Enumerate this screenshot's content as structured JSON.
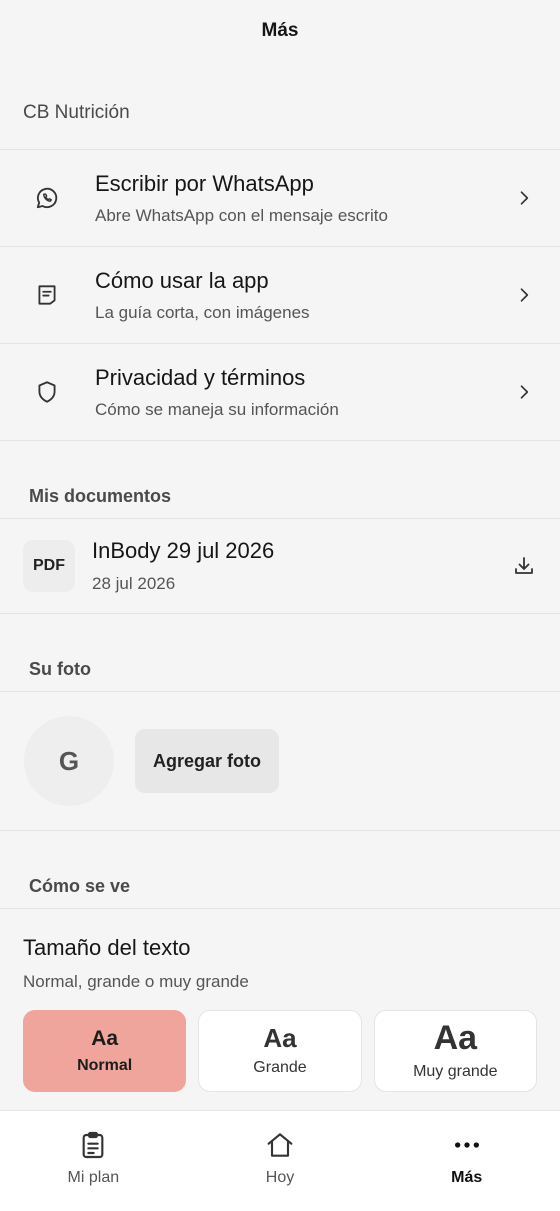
{
  "header": {
    "title": "Más"
  },
  "org": {
    "name": "CB Nutrición"
  },
  "menu": [
    {
      "title": "Escribir por WhatsApp",
      "subtitle": "Abre WhatsApp con el mensaje escrito",
      "icon": "whatsapp-icon"
    },
    {
      "title": "Cómo usar la app",
      "subtitle": "La guía corta, con imágenes",
      "icon": "guide-icon"
    },
    {
      "title": "Privacidad y términos",
      "subtitle": "Cómo se maneja su información",
      "icon": "shield-icon"
    }
  ],
  "documents": {
    "section_title": "Mis documentos",
    "items": [
      {
        "badge": "PDF",
        "title": "InBody 29 jul 2026",
        "date": "28 jul 2026"
      }
    ]
  },
  "photo": {
    "section_title": "Su foto",
    "initial": "G",
    "add_label": "Agregar foto"
  },
  "appearance": {
    "section_title": "Cómo se ve",
    "text_size_title": "Tamaño del texto",
    "text_size_subtitle": "Normal, grande o muy grande",
    "options": [
      {
        "sample": "Aa",
        "label": "Normal",
        "selected": true
      },
      {
        "sample": "Aa",
        "label": "Grande",
        "selected": false
      },
      {
        "sample": "Aa",
        "label": "Muy grande",
        "selected": false
      }
    ],
    "accent": "#efa59c"
  },
  "tabbar": [
    {
      "label": "Mi plan",
      "icon": "clipboard-icon",
      "active": false
    },
    {
      "label": "Hoy",
      "icon": "home-icon",
      "active": false
    },
    {
      "label": "Más",
      "icon": "more-icon",
      "active": true
    }
  ]
}
